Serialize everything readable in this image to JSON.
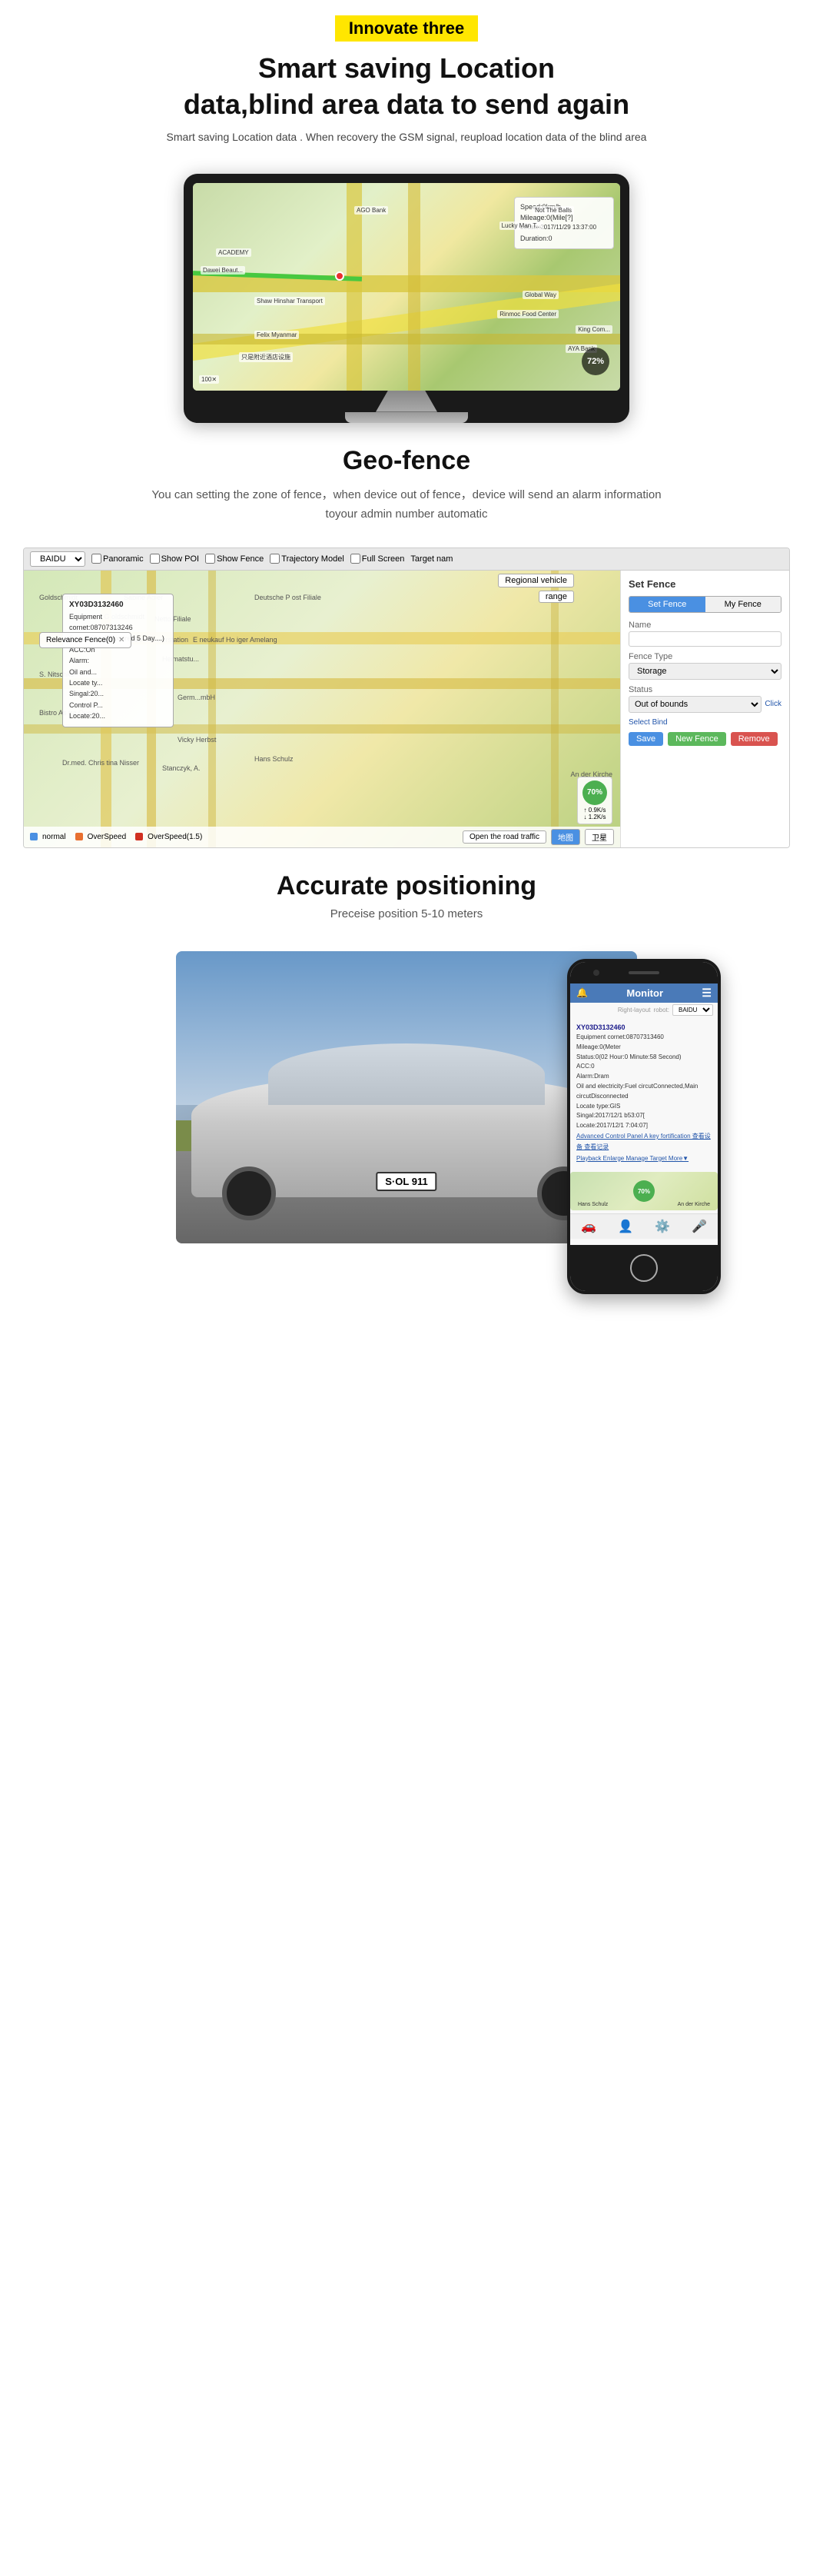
{
  "header": {
    "badge": "Innovate three",
    "title_line1": "Smart saving Location",
    "title_line2": "data,blind area data to send again",
    "description": "Smart saving Location data . When recovery the GSM signal, reupload location data of the blind area"
  },
  "monitor": {
    "map_popup": {
      "speed": "Speed:0km/h",
      "mileage": "Mileage:0(Mile[?]",
      "locate": "Locate:2017/11/29 13:37:00",
      "duration": "Duration:0"
    },
    "percentage": "72%"
  },
  "geofence": {
    "title": "Geo-fence",
    "description": "You can setting the zone of fence，when device out of fence，device will send an alarm information toyour admin number automatic"
  },
  "map_ui": {
    "toolbar": {
      "dropdown": "BAIDU",
      "panoramic": "Panoramic",
      "show_poi": "Show POI",
      "show_fence": "Show Fence",
      "trajectory": "Trajectory Model",
      "fullscreen": "Full Screen",
      "target": "Target nam"
    },
    "legend": {
      "normal": "normal",
      "overspeed": "OverSpeed",
      "overspeed_1_5": "OverSpeed(1.5)"
    },
    "vehicle_popup": {
      "id": "XY03D3132460",
      "equipment": "Equipment cornet:08707313246",
      "speed": "Speed:0km/h(expired 5 Day....)",
      "acc": "ACC:On",
      "alarm": "Alarm:",
      "oil": "Oil and...",
      "locate_type": "Locate ty...",
      "signal": "Singal:20...",
      "control": "Control P...",
      "locate": "Locate:20..."
    },
    "relevance_fence": "Relevance Fence(0)",
    "regional_vehicle": "Regional vehicle",
    "range_btn": "range",
    "set_fence": {
      "title": "Set Fence",
      "tab_set": "Set Fence",
      "tab_my": "My Fence",
      "name_label": "Name",
      "fence_type_label": "Fence Type",
      "fence_type_value": "Storage",
      "status_label": "Status",
      "status_value": "Out of bounds",
      "click_label": "Click",
      "select_bind": "Select Bind",
      "btn_save": "Save",
      "btn_new": "New Fence",
      "btn_remove": "Remove"
    },
    "speed_badge": {
      "percentage": "70%",
      "up_speed": "0.9K/s",
      "down_speed": "1.2K/s"
    }
  },
  "accurate": {
    "title": "Accurate positioning",
    "description": "Preceise position 5-10 meters"
  },
  "phone": {
    "app_title": "Monitor",
    "vehicle_id": "XY03D3132460",
    "equipment": "Equipment cornet:08707313460",
    "mileage": "Mileage:0(Meter",
    "status": "Status:0(02 Hour:0 Minute:58 Second)",
    "acc": "ACC:0",
    "alarm": "Alarm:Dram",
    "oil": "Oil and electricity:Fuel circutConnected,Main circutDisconnected",
    "locate_type": "Locate type:GIS",
    "signal": "Singal:2017/12/1 b53:07[",
    "locate": "Locate:2017/12/1 7:04:07]",
    "links": "Advanced Control Panel A key fortification 查看设备 查看记录",
    "links2": "Playback Enlarge Manage Target More▼",
    "map_badge": "70%",
    "driver": "Hans Schulz",
    "location": "An der Kirche"
  },
  "car": {
    "plate": "S·OL 911"
  }
}
